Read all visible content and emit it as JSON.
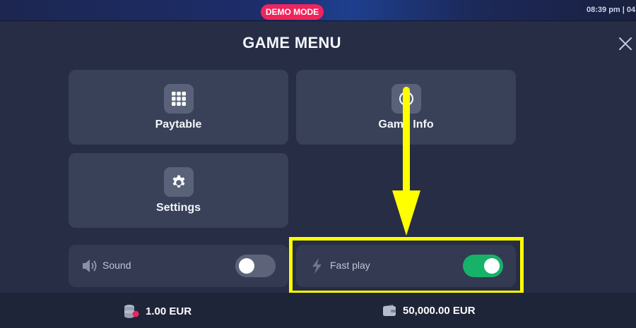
{
  "topbar": {
    "badge": "DEMO MODE",
    "clock": "08:39 pm | 04:"
  },
  "menu": {
    "title": "GAME MENU",
    "tiles": [
      {
        "label": "Paytable",
        "icon": "grid-icon"
      },
      {
        "label": "Game Info",
        "icon": "info-icon"
      },
      {
        "label": "Settings",
        "icon": "gear-icon"
      }
    ],
    "toggles": [
      {
        "label": "Sound",
        "icon": "speaker-icon",
        "on": false
      },
      {
        "label": "Fast play",
        "icon": "lightning-icon",
        "on": true
      }
    ]
  },
  "footer": {
    "bet": "1.00 EUR",
    "balance": "50,000.00 EUR"
  },
  "colors": {
    "background": "#262d45",
    "tile": "#394159",
    "badge": "#f0245c",
    "toggle_on": "#17b26a",
    "annotation": "#ffff00"
  }
}
